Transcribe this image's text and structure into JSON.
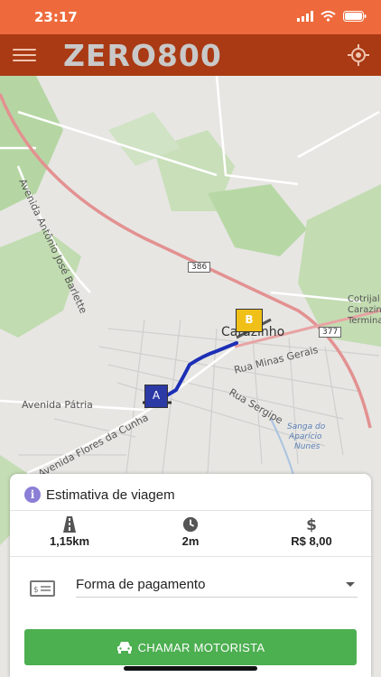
{
  "status_bar": {
    "time": "23:17"
  },
  "app_bar": {
    "title": "ZERO800"
  },
  "map": {
    "labels": {
      "avenida_antonio_jose_barlette": "Avenida Antônio José Barlette",
      "road_386": "386",
      "road_377": "377",
      "city": "Carazinho",
      "cotrijal": "Cotrijal",
      "cotrijal_line2": "Carazinho",
      "cotrijal_line3": "Terminal",
      "rua_minas_gerais": "Rua Minas Gerais",
      "rua_sergipe": "Rua Sergipe",
      "avenida_patria": "Avenida Pátria",
      "avenida_flores_da_cunha": "Avenida Flores da Cunha",
      "sanga": "Sanga do",
      "sanga_line2": "Aparício",
      "sanga_line3": "Nunes"
    },
    "marker_a": "A",
    "marker_b": "B"
  },
  "trip": {
    "title": "Estimativa de viagem",
    "distance": "1,15km",
    "duration": "2m",
    "price": "R$ 8,00"
  },
  "payment": {
    "label": "Forma de pagamento"
  },
  "action": {
    "call_label": "CHAMAR MOTORISTA"
  },
  "colors": {
    "status_bar": "#ee6a3c",
    "app_bar": "#a93a14",
    "button": "#4caf50",
    "route": "#1c2fb5",
    "info_icon": "#8a7fd6"
  },
  "icons": [
    "wifi-icon",
    "signal-icon",
    "battery-icon",
    "menu-icon",
    "locate-icon",
    "road-icon",
    "clock-icon",
    "dollar-icon",
    "cash-icon",
    "car-icon",
    "info-icon",
    "caret-down-icon"
  ]
}
